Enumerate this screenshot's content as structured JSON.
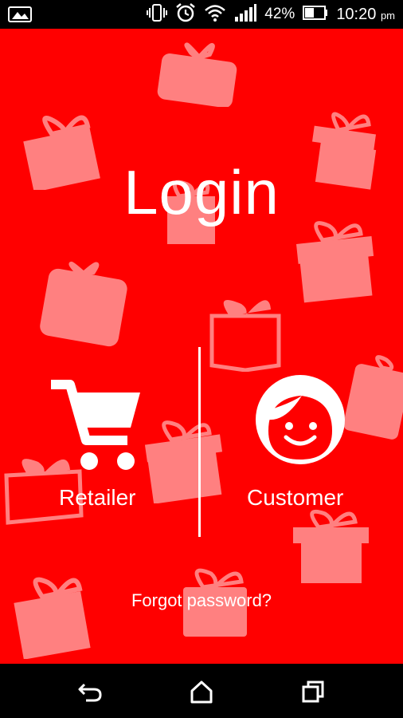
{
  "status_bar": {
    "battery_percent": "42%",
    "time": "10:20",
    "time_suffix": "pm",
    "icons": [
      "photo-icon",
      "vibrate-icon",
      "alarm-icon",
      "wifi-icon",
      "signal-icon",
      "battery-icon"
    ]
  },
  "login": {
    "title": "Login",
    "retailer_label": "Retailer",
    "customer_label": "Customer",
    "forgot_password": "Forgot password?"
  },
  "nav_bar": {
    "icons": [
      "back-icon",
      "home-icon",
      "recents-icon"
    ]
  },
  "colors": {
    "background": "#ff0000",
    "text": "#ffffff",
    "decor": "#ffffff"
  }
}
